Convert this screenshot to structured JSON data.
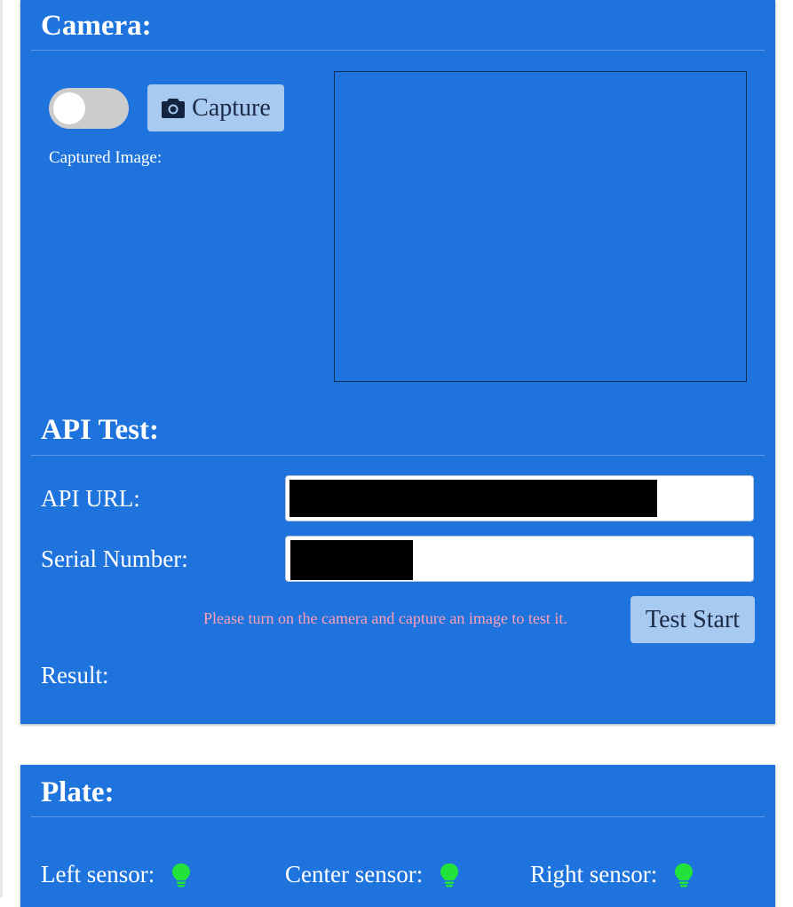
{
  "camera": {
    "heading": "Camera:",
    "toggle_on": false,
    "capture_label": "Capture",
    "capture_icon": "camera-icon",
    "captured_image_label": "Captured Image:"
  },
  "api_test": {
    "heading": "API Test:",
    "api_url_label": "API URL:",
    "serial_number_label": "Serial Number:",
    "hint": "Please turn on the camera and capture an image to test it.",
    "test_start_label": "Test Start",
    "result_label": "Result:"
  },
  "plate": {
    "heading": "Plate:",
    "sensors": [
      {
        "label": "Left sensor:",
        "icon": "lightbulb-icon",
        "status_color": "#22e33a"
      },
      {
        "label": "Center sensor:",
        "icon": "lightbulb-icon",
        "status_color": "#22e33a"
      },
      {
        "label": "Right sensor:",
        "icon": "lightbulb-icon",
        "status_color": "#22e33a"
      }
    ]
  },
  "colors": {
    "panel": "#1e73dd",
    "button": "#a8c9f0",
    "hint": "#ff9fb6"
  }
}
